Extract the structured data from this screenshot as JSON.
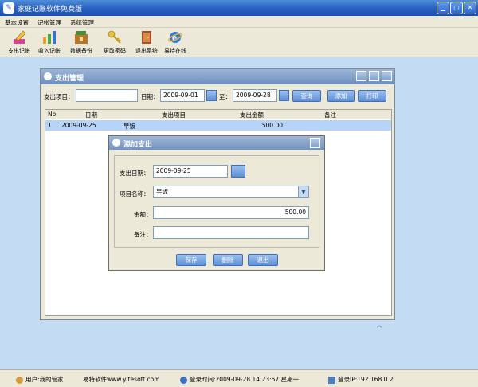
{
  "window": {
    "title": "家庭记账软件免费版"
  },
  "menu": [
    "基本设置",
    "记帐管理",
    "系统管理"
  ],
  "toolbar": {
    "expense": "支出记帐",
    "income": "收入记帐",
    "backup": "数据备份",
    "password": "更改密码",
    "exit": "退出系统",
    "online": "易特在线"
  },
  "child": {
    "title": "支出管理",
    "filter": {
      "item_label": "支出项目：",
      "item_value": "",
      "date_label": "日期：",
      "date_from": "2009-09-01",
      "to_label": "至：",
      "date_to": "2009-09-28",
      "query": "查询",
      "add": "添加",
      "print": "打印"
    },
    "table": {
      "headers": [
        "No.",
        "日期",
        "支出项目",
        "支出金额",
        "备注"
      ],
      "rows": [
        {
          "no": "1",
          "date": "2009-09-25",
          "item": "早饭",
          "amount": "500.00",
          "note": ""
        }
      ]
    }
  },
  "dialog": {
    "title": "添加支出",
    "date_label": "支出日期：",
    "date_value": "2009-09-25",
    "item_label": "项目名称：",
    "item_value": "早饭",
    "amount_label": "金额：",
    "amount_value": "500.00",
    "note_label": "备注：",
    "note_value": "",
    "save": "保存",
    "delete": "删除",
    "exit": "退出"
  },
  "status": {
    "user": "用户:我的管家",
    "site": "易特软件www.yitesoft.com",
    "login_time": "登录时间:2009-09-28 14:23:57 星期一",
    "login_ip": "登录IP:192.168.0.2"
  },
  "colors": {
    "title_blue": "#2a62c4",
    "selected_row": "#b7d3f5",
    "desktop": "#c3dbf3"
  }
}
